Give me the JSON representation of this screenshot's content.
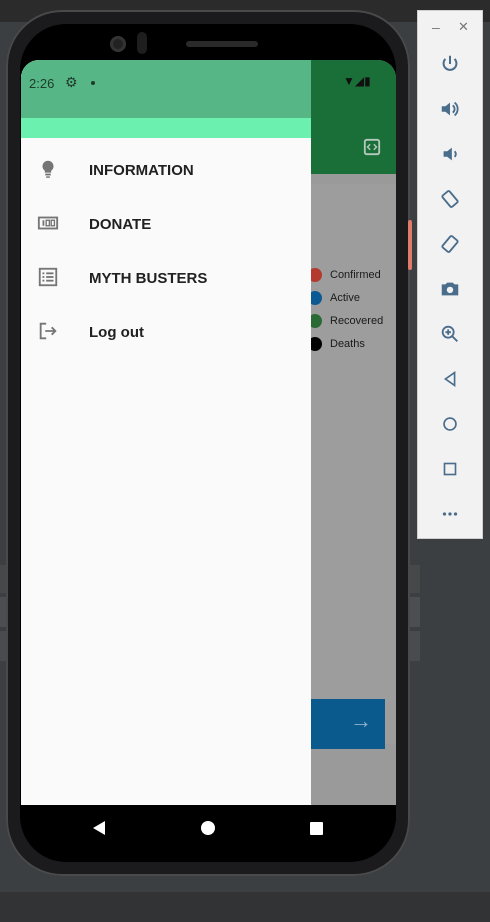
{
  "status_bar": {
    "time": "2:26"
  },
  "drawer": {
    "items": [
      {
        "label": "INFORMATION",
        "icon": "lightbulb-icon"
      },
      {
        "label": "DONATE",
        "icon": "donate-icon"
      },
      {
        "label": "MYTH BUSTERS",
        "icon": "list-icon"
      },
      {
        "label": "Log out",
        "icon": "logout-icon"
      }
    ]
  },
  "background_legend": [
    {
      "label": "Confirmed",
      "color": "#b23a2e"
    },
    {
      "label": "Active",
      "color": "#0b5a93"
    },
    {
      "label": "Recovered",
      "color": "#2a6a34"
    },
    {
      "label": "Deaths",
      "color": "#000000"
    }
  ],
  "colors": {
    "drawer_status": "#56b685",
    "drawer_header": "#6cf0b0",
    "app_bar": "#1a6f39",
    "scrim_accent": "#0a5a8e"
  },
  "emulator_toolbar": {
    "buttons": [
      "power-icon",
      "volume-up-icon",
      "volume-down-icon",
      "rotate-left-icon",
      "rotate-right-icon",
      "camera-icon",
      "zoom-icon",
      "back-icon",
      "home-icon",
      "overview-icon",
      "more-icon"
    ]
  }
}
